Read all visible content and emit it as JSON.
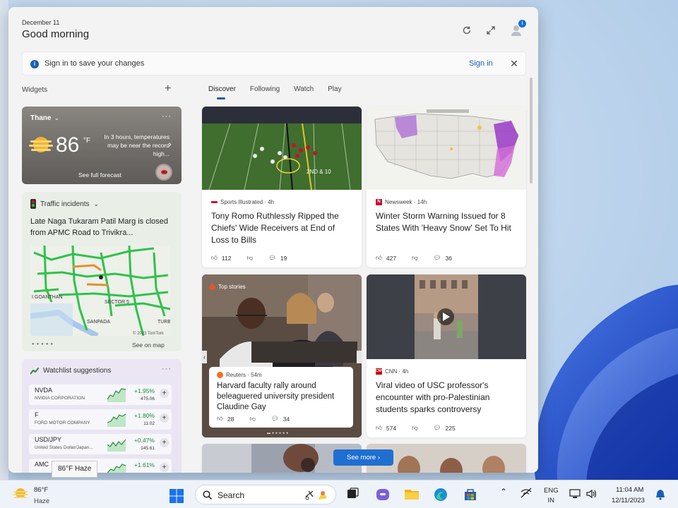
{
  "header": {
    "date": "December 11",
    "greeting": "Good morning"
  },
  "signin_bar": {
    "message": "Sign in to save your changes",
    "link": "Sign in"
  },
  "widgets": {
    "label": "Widgets",
    "add": "+"
  },
  "tabs": [
    {
      "label": "Discover",
      "active": true
    },
    {
      "label": "Following"
    },
    {
      "label": "Watch"
    },
    {
      "label": "Play"
    }
  ],
  "weather": {
    "city": "Thane",
    "temp": "86",
    "unit": "°F",
    "note": "In 3 hours, temperatures may be near the record high...",
    "full_forecast": "See full forecast"
  },
  "traffic": {
    "title": "Traffic incidents",
    "incident": "Late Naga Tukaram Patil Marg is closed from APMC Road to Trivikra...",
    "see_on_map": "See on map",
    "map_labels": [
      "I GOANTHAN",
      "SECTOR 5",
      "SANPADA",
      "© 2023 TomTom",
      "TURB"
    ]
  },
  "watchlist": {
    "title": "Watchlist suggestions",
    "stocks": [
      {
        "symbol": "NVDA",
        "name": "NVIDIA CORPORATION",
        "change": "+1.95%",
        "price": "475.06"
      },
      {
        "symbol": "F",
        "name": "FORD MOTOR COMPANY",
        "change": "+1.80%",
        "price": "11.02"
      },
      {
        "symbol": "USD/JPY",
        "name": "United States Dollar/Japan...",
        "change": "+0.47%",
        "price": "145.61"
      },
      {
        "symbol": "AMC",
        "name": "",
        "change": "+1.61%",
        "price": ""
      }
    ]
  },
  "feed": {
    "cards": [
      {
        "source": "Sports Illustrated · 4h",
        "headline": "Tony Romo Ruthlessly Ripped the Chiefs' Wide Receivers at End of Loss to Bills",
        "likes": "112",
        "comments": "19",
        "overlay": "2ND & 10"
      },
      {
        "source": "Newsweek · 14h",
        "headline": "Winter Storm Warning Issued for 8 States With 'Heavy Snow' Set To Hit",
        "likes": "427",
        "comments": "36"
      },
      {
        "label": "Top stories",
        "source": "Reuters · 54m",
        "headline": "Harvard faculty rally around beleaguered university president Claudine Gay",
        "likes": "28",
        "comments": "34"
      },
      {
        "source": "CNN · 4h",
        "headline": "Viral video of USC professor's encounter with pro-Palestinian students sparks controversy",
        "likes": "574",
        "comments": "225"
      }
    ],
    "see_more": "See more"
  },
  "taskbar": {
    "weather_temp": "86°F",
    "weather_cond": "Haze",
    "tooltip": "86°F Haze",
    "search": "Search",
    "lang_top": "ENG",
    "lang_bottom": "IN",
    "time": "11:04 AM",
    "date": "12/11/2023"
  },
  "colors": {
    "accent": "#1a5fb4",
    "positive": "#1a8a3a",
    "see_more_bg": "#1f6fd1"
  }
}
